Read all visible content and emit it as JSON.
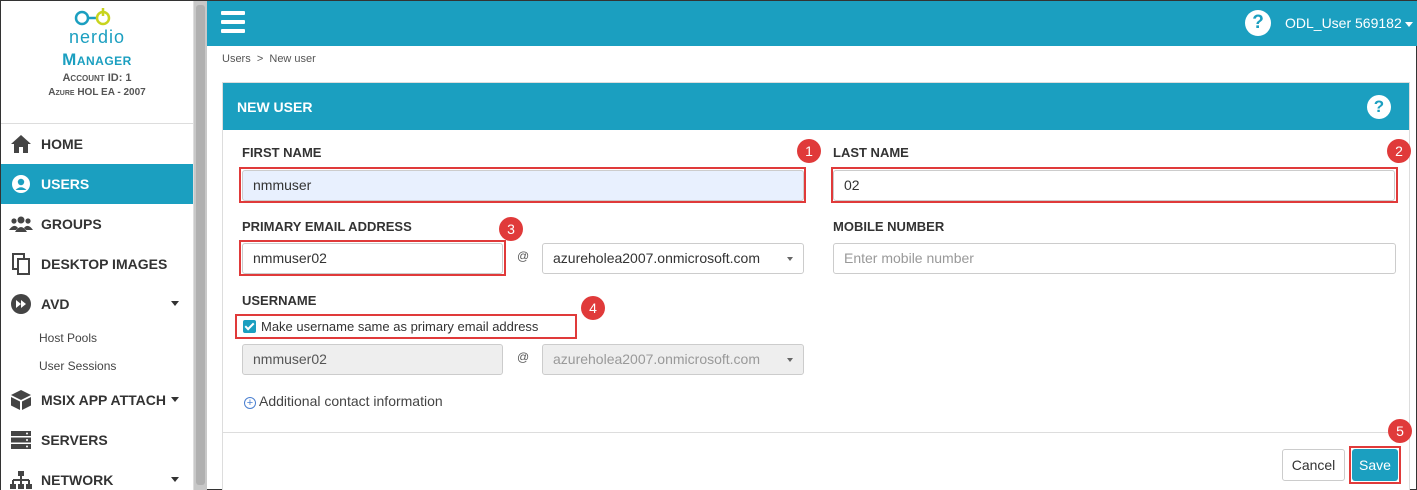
{
  "brand": {
    "logo_text": "nerdio",
    "title": "Manager",
    "account_id": "Account ID: 1",
    "account_name": "Azure HOL EA - 2007"
  },
  "sidebar": {
    "items": [
      {
        "label": "HOME",
        "icon": "home-icon"
      },
      {
        "label": "USERS",
        "icon": "user-icon",
        "active": true
      },
      {
        "label": "GROUPS",
        "icon": "groups-icon"
      },
      {
        "label": "DESKTOP IMAGES",
        "icon": "copy-icon"
      },
      {
        "label": "AVD",
        "icon": "avd-icon",
        "expandable": true
      },
      {
        "label": "MSIX APP ATTACH",
        "icon": "package-icon",
        "expandable": true
      },
      {
        "label": "SERVERS",
        "icon": "server-icon"
      },
      {
        "label": "NETWORK",
        "icon": "network-icon",
        "expandable": true
      }
    ],
    "avd_subitems": [
      "Host Pools",
      "User Sessions"
    ]
  },
  "topbar": {
    "help_label": "?",
    "user_label": "ODL_User 569182"
  },
  "breadcrumb": "Users  >  New user",
  "panel": {
    "title": "NEW USER",
    "help_label": "?"
  },
  "form": {
    "first_name_label": "FIRST NAME",
    "first_name_value": "nmmuser",
    "last_name_label": "LAST NAME",
    "last_name_value": "02",
    "email_label": "PRIMARY EMAIL ADDRESS",
    "email_value": "nmmuser02",
    "at_symbol": "@",
    "domain_value": "azureholea2007.onmicrosoft.com",
    "mobile_label": "MOBILE NUMBER",
    "mobile_placeholder": "Enter mobile number",
    "username_label": "USERNAME",
    "same_as_email_label": "Make username same as primary email address",
    "same_as_email_checked": true,
    "username_value": "nmmuser02",
    "username_domain": "azureholea2007.onmicrosoft.com",
    "additional_contact": "Additional contact information"
  },
  "buttons": {
    "cancel": "Cancel",
    "save": "Save"
  },
  "callouts": [
    "1",
    "2",
    "3",
    "4",
    "5"
  ],
  "colors": {
    "accent": "#1b9fc0",
    "callout": "#e03a3a"
  }
}
